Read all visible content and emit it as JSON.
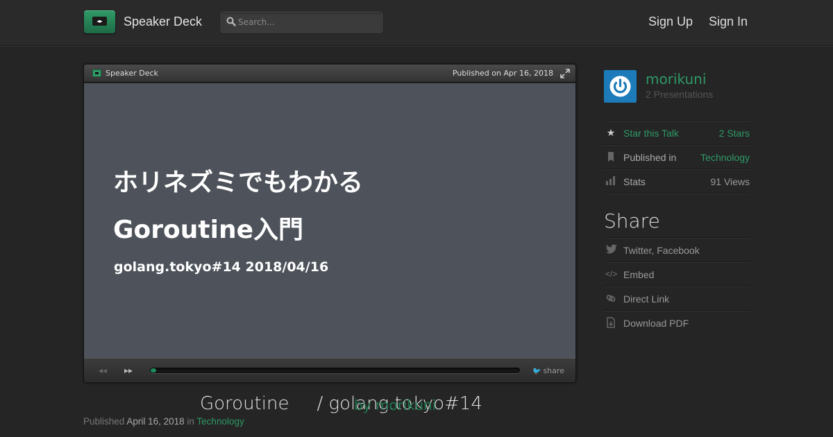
{
  "header": {
    "brand": "Speaker Deck",
    "search_placeholder": "Search...",
    "sign_up": "Sign Up",
    "sign_in": "Sign In"
  },
  "player": {
    "brand": "Speaker Deck",
    "published": "Published on Apr 16, 2018",
    "slide": {
      "line1": "ホリネズミでもわかる",
      "line2": "Goroutine入門",
      "line3": "golang.tokyo#14 2018/04/16"
    },
    "share_label": "share",
    "progress_fraction": 0.015
  },
  "talk": {
    "title_part1": "Goroutine",
    "title_part2": "/ golang.tokyo#14",
    "byline_overlap": "by morikuni",
    "meta_prefix": "Published",
    "meta_date": "April 16, 2018",
    "meta_in": "in",
    "meta_category": "Technology"
  },
  "sidebar": {
    "username": "morikuni",
    "presentations": "2 Presentations",
    "rows": [
      {
        "label": "Star this Talk",
        "value": "2 Stars",
        "icon": "star-icon"
      },
      {
        "label": "Published in",
        "value": "Technology",
        "icon": "bookmark-icon"
      },
      {
        "label": "Stats",
        "value": "91 Views",
        "icon": "bar-chart-icon"
      }
    ],
    "share_heading": "Share",
    "share_rows": [
      {
        "label": "Twitter, Facebook",
        "icon": "twitter-icon"
      },
      {
        "label": "Embed",
        "icon": "code-icon"
      },
      {
        "label": "Direct Link",
        "icon": "link-icon"
      },
      {
        "label": "Download PDF",
        "icon": "download-icon"
      }
    ]
  },
  "colors": {
    "accent_green": "#2e9966",
    "avatar_blue": "#1c7bb8",
    "slide_bg": "#4e535b"
  }
}
